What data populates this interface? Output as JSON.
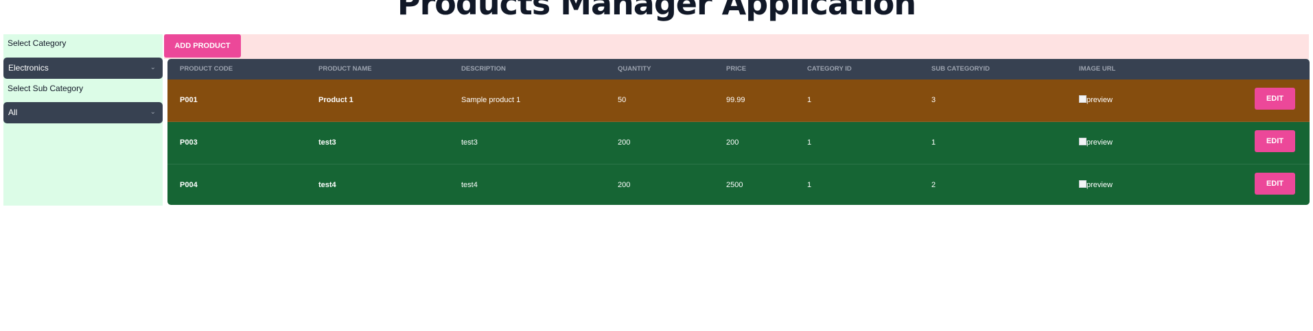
{
  "page": {
    "title": "Products Manager Application"
  },
  "sidebar": {
    "category_label": "Select Category",
    "category_value": "Electronics",
    "subcategory_label": "Select Sub Category",
    "subcategory_value": "All"
  },
  "toolbar": {
    "add_label": "ADD PRODUCT"
  },
  "table": {
    "headers": [
      "PRODUCT CODE",
      "PRODUCT NAME",
      "DESCRIPTION",
      "QUANTITY",
      "PRICE",
      "CATEGORY ID",
      "SUB CATEGORYID",
      "IMAGE URL"
    ],
    "rows": [
      {
        "code": "P001",
        "name": "Product 1",
        "description": "Sample product 1",
        "quantity": "50",
        "price": "99.99",
        "category_id": "1",
        "subcategory_id": "3",
        "image_alt": "preview",
        "edit_label": "EDIT",
        "row_color": "#854d0e"
      },
      {
        "code": "P003",
        "name": "test3",
        "description": "test3",
        "quantity": "200",
        "price": "200",
        "category_id": "1",
        "subcategory_id": "1",
        "image_alt": "preview",
        "edit_label": "EDIT",
        "row_color": "#166534"
      },
      {
        "code": "P004",
        "name": "test4",
        "description": "test4",
        "quantity": "200",
        "price": "2500",
        "category_id": "1",
        "subcategory_id": "2",
        "image_alt": "preview",
        "edit_label": "EDIT",
        "row_color": "#166534"
      }
    ]
  },
  "colors": {
    "accent": "#ec4899",
    "header_bg": "#374151",
    "sidebar_bg": "#dcfce7",
    "toolbar_bg": "#fee2e2"
  },
  "icons": {
    "select_chevron": "chevron-down-icon",
    "image_placeholder": "broken-image-icon"
  }
}
